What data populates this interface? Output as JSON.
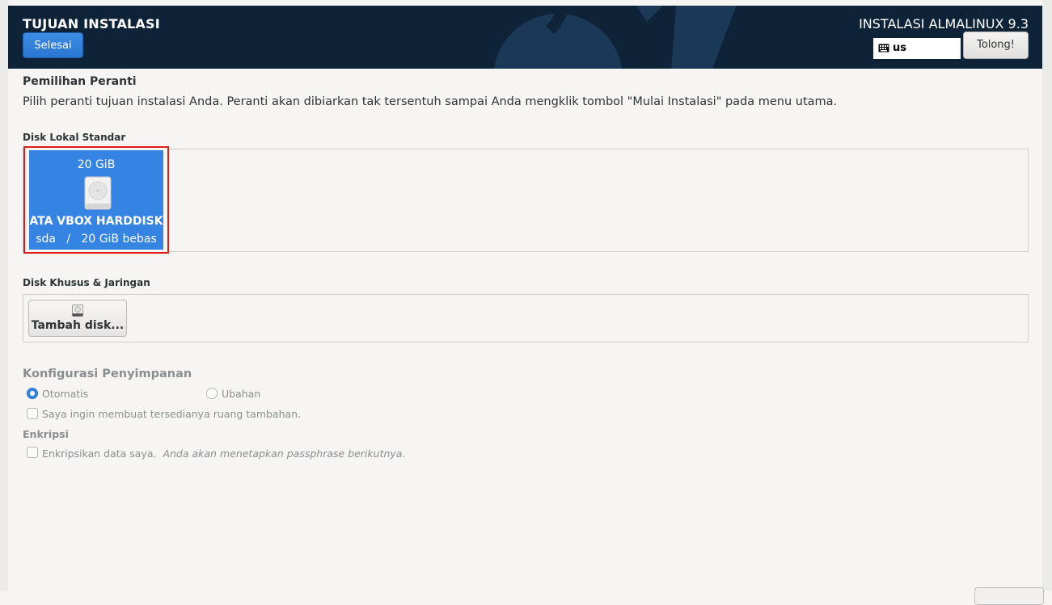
{
  "header": {
    "page_title": "TUJUAN INSTALASI",
    "done_label": "Selesai",
    "product_title": "INSTALASI ALMALINUX 9.3",
    "keyboard_layout": "us",
    "help_label": "Tolong!"
  },
  "device_selection": {
    "heading": "Pemilihan Peranti",
    "description": "Pilih peranti tujuan instalasi Anda. Peranti akan dibiarkan tak tersentuh sampai Anda mengklik tombol \"Mulai Instalasi\" pada menu utama.",
    "local_label": "Disk Lokal Standar",
    "disks": [
      {
        "size": "20 GiB",
        "name": "ATA VBOX HARDDISK",
        "info": "sda   /   20 GiB bebas",
        "selected": true,
        "icon": "harddisk-icon"
      }
    ],
    "specialized_label": "Disk Khusus & Jaringan",
    "add_disk_label": "Tambah disk..."
  },
  "storage_config": {
    "heading": "Konfigurasi Penyimpanan",
    "options": [
      {
        "label": "Otomatis",
        "selected": true
      },
      {
        "label": "Ubahan",
        "selected": false
      }
    ],
    "extra_space_label": "Saya ingin membuat tersedianya ruang tambahan."
  },
  "encryption": {
    "heading": "Enkripsi",
    "checkbox_label": "Enkripsikan data saya.",
    "hint": "Anda akan menetapkan passphrase berikutnya."
  },
  "colors": {
    "header_bg": "#0f2338",
    "accent": "#3584e4",
    "selection_outline": "#e01b1b"
  }
}
